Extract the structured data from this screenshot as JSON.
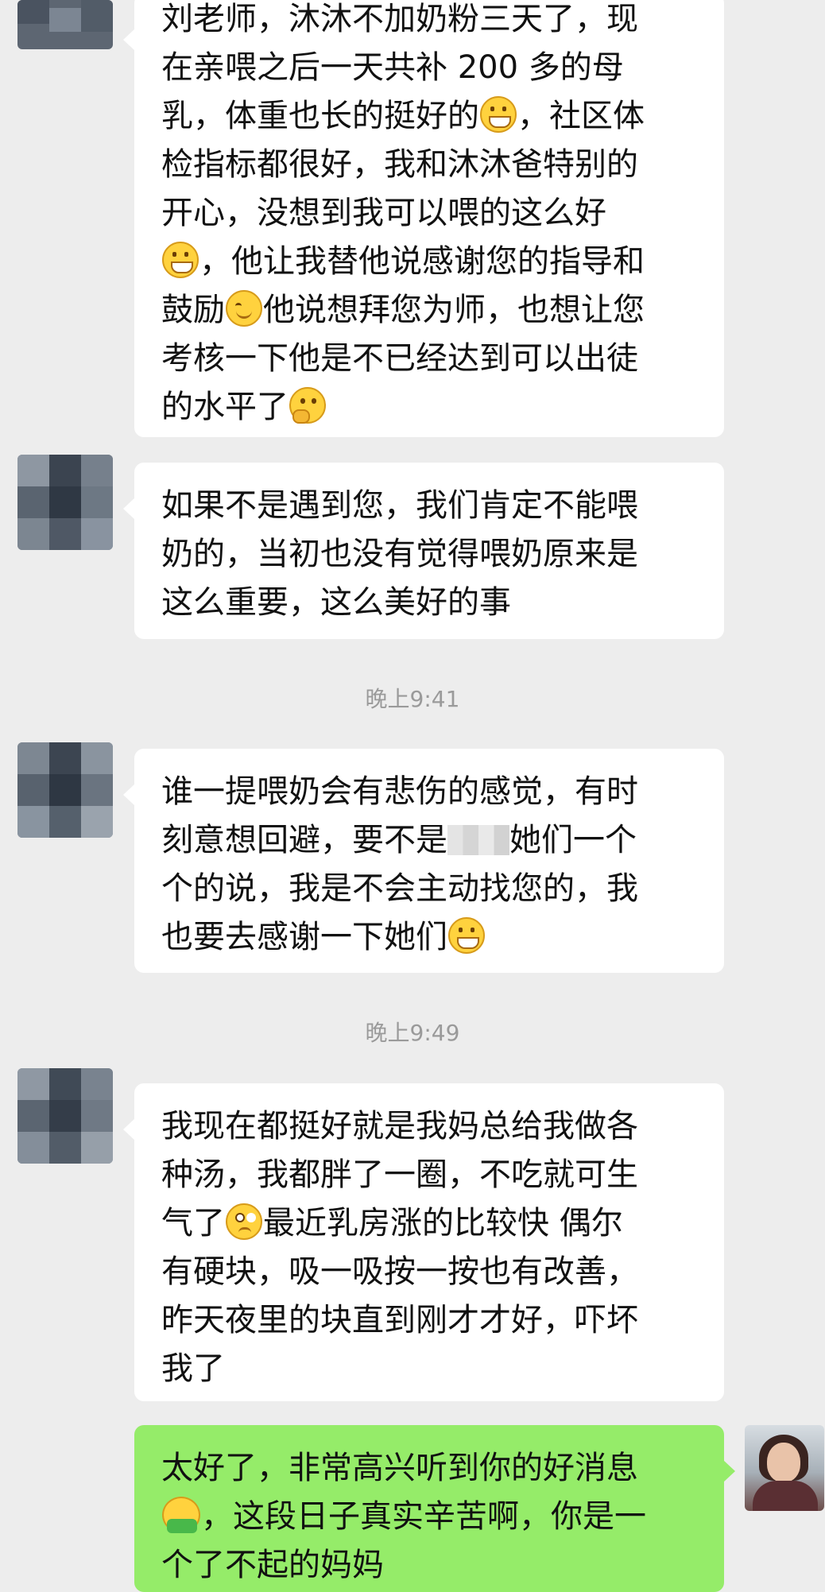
{
  "messages": [
    {
      "lines": [
        "刘老师，沐沐不加奶粉三天了，现",
        "在亲喂之后一天共补 200 多的母",
        "乳，体重也长的挺好的[grin]，社区体",
        "检指标都很好，我和沐沐爸特别的",
        "开心，没想到我可以喂的这么好",
        "[grin]，他让我替他说感谢您的指导和",
        "鼓励[smile]他说想拜您为师，也想让您",
        "考核一下他是不已经达到可以出徒",
        "的水平了[think]"
      ]
    },
    {
      "lines": [
        "如果不是遇到您，我们肯定不能喂",
        "奶的，当初也没有觉得喂奶原来是",
        "这么重要，这么美好的事"
      ]
    },
    {
      "lines": [
        "谁一提喂奶会有悲伤的感觉，有时",
        "刻意想回避，要不是[blur]她们一个",
        "个的说，我是不会主动找您的，我",
        "也要去感谢一下她们[grin]"
      ]
    },
    {
      "lines": [
        "我现在都挺好就是我妈总给我做各",
        "种汤，我都胖了一圈，不吃就可生",
        "气了[confused]最近乳房涨的比较快 偶尔",
        "有硬块，吸一吸按一按也有改善，",
        "昨天夜里的块直到刚才才好，吓坏",
        "我了"
      ]
    },
    {
      "lines": [
        "太好了，非常高兴听到你的好消息",
        "[hug]，这段日子真实辛苦啊，你是一",
        "个了不起的妈妈"
      ]
    }
  ],
  "timestamps": {
    "t1": "晚上9:41",
    "t2": "晚上9:49"
  },
  "colors": {
    "background": "#ededed",
    "incoming_bubble": "#ffffff",
    "outgoing_bubble": "#95ec69",
    "timestamp_text": "#9a9a9a"
  },
  "icons": {
    "grin": "grinning-face-emoji",
    "smile": "smiling-face-emoji",
    "think": "thinking-face-emoji",
    "confused": "confused-face-emoji",
    "hug": "hugging-person-emoji"
  }
}
